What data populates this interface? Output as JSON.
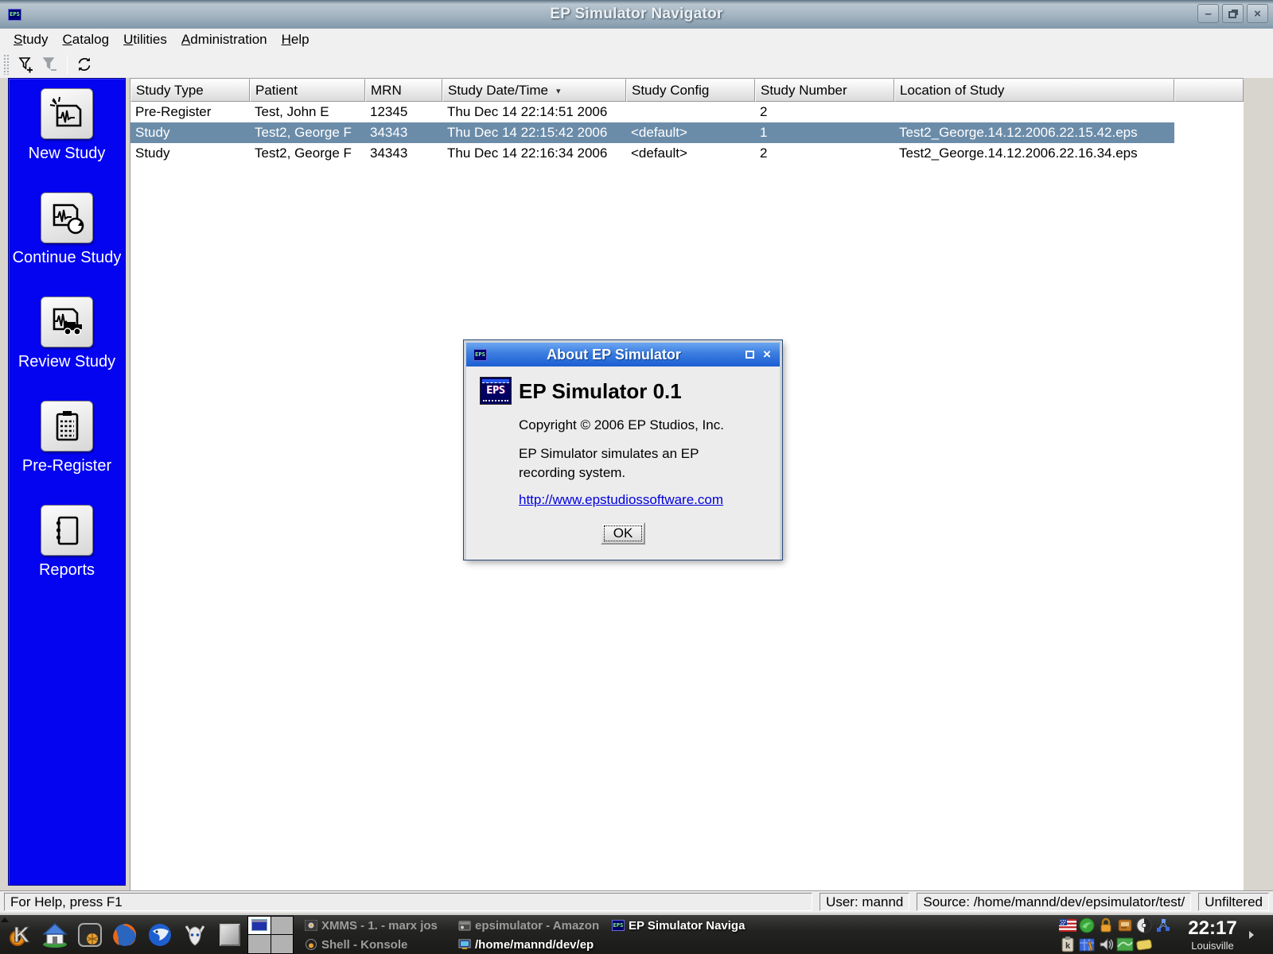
{
  "window": {
    "title": "EP Simulator Navigator",
    "app_icon": "EPS",
    "buttons": [
      "minimize",
      "restore",
      "close"
    ]
  },
  "menubar": {
    "items": [
      {
        "key": "S",
        "rest": "tudy"
      },
      {
        "key": "C",
        "rest": "atalog"
      },
      {
        "key": "U",
        "rest": "tilities"
      },
      {
        "key": "A",
        "rest": "dministration"
      },
      {
        "key": "H",
        "rest": "elp"
      }
    ]
  },
  "toolbar": {
    "icons": [
      "filter-add",
      "filter-remove",
      "refresh"
    ]
  },
  "sidebar": {
    "background_color": "#0404f0",
    "items": [
      {
        "label": "New Study",
        "icon": "new-study-ecg-document"
      },
      {
        "label": "Continue Study",
        "icon": "continue-study-ecg-clock"
      },
      {
        "label": "Review Study",
        "icon": "review-study-ecg-truck"
      },
      {
        "label": "Pre-Register",
        "icon": "pre-register-clipboard"
      },
      {
        "label": "Reports",
        "icon": "reports-notebook"
      }
    ]
  },
  "table": {
    "columns": [
      "Study Type",
      "Patient",
      "MRN",
      "Study Date/Time",
      "Study Config",
      "Study Number",
      "Location of Study"
    ],
    "sort_column": "Study Date/Time",
    "sort_indicator": "▾",
    "selected_row_color": "#6b8ca9",
    "rows": [
      {
        "selected": false,
        "cells": [
          "Pre-Register",
          "Test, John E",
          "12345",
          "Thu Dec 14 22:14:51 2006",
          "",
          "2",
          ""
        ]
      },
      {
        "selected": true,
        "cells": [
          "Study",
          "Test2, George F",
          "34343",
          "Thu Dec 14 22:15:42 2006",
          "<default>",
          "1",
          "Test2_George.14.12.2006.22.15.42.eps"
        ]
      },
      {
        "selected": false,
        "cells": [
          "Study",
          "Test2, George F",
          "34343",
          "Thu Dec 14 22:16:34 2006",
          "<default>",
          "2",
          "Test2_George.14.12.2006.22.16.34.eps"
        ]
      }
    ]
  },
  "dialog": {
    "title": "About EP Simulator",
    "app_name": "EP Simulator 0.1",
    "copyright": "Copyright © 2006 EP Studios, Inc.",
    "description": "EP Simulator simulates an EP recording system.",
    "link": "http://www.epstudiossoftware.com",
    "ok_label": "OK",
    "titlebar_color": "#1b5ed2"
  },
  "statusbar": {
    "help": "For Help, press F1",
    "user": "User: mannd",
    "source": "Source: /home/mannd/dev/epsimulator/test/",
    "filter": "Unfiltered"
  },
  "taskbar": {
    "launchers": [
      "kde-menu",
      "home-folder",
      "konsole",
      "firefox",
      "thunderbird",
      "media-player",
      "show-desktop"
    ],
    "pager_desktops": 4,
    "tasks": [
      {
        "label": "XMMS - 1.  - marx jos",
        "active": false
      },
      {
        "label": "epsimulator - Amazon",
        "active": false
      },
      {
        "label": "EP Simulator Naviga",
        "active": true
      },
      {
        "label": "Shell - Konsole",
        "active": false
      },
      {
        "label": "/home/mannd/dev/ep",
        "active": true
      }
    ],
    "tray_icons": [
      "keyboard-layout-us-flag",
      "suse-geeko",
      "wallet-lock",
      "kwallet-panel",
      "cd-player",
      "network-monitor",
      "klipper-clipboard",
      "organizer-calendar",
      "volume-mixer",
      "system-map",
      "soap-note"
    ],
    "clock_time": "22:17",
    "clock_city": "Louisville"
  }
}
